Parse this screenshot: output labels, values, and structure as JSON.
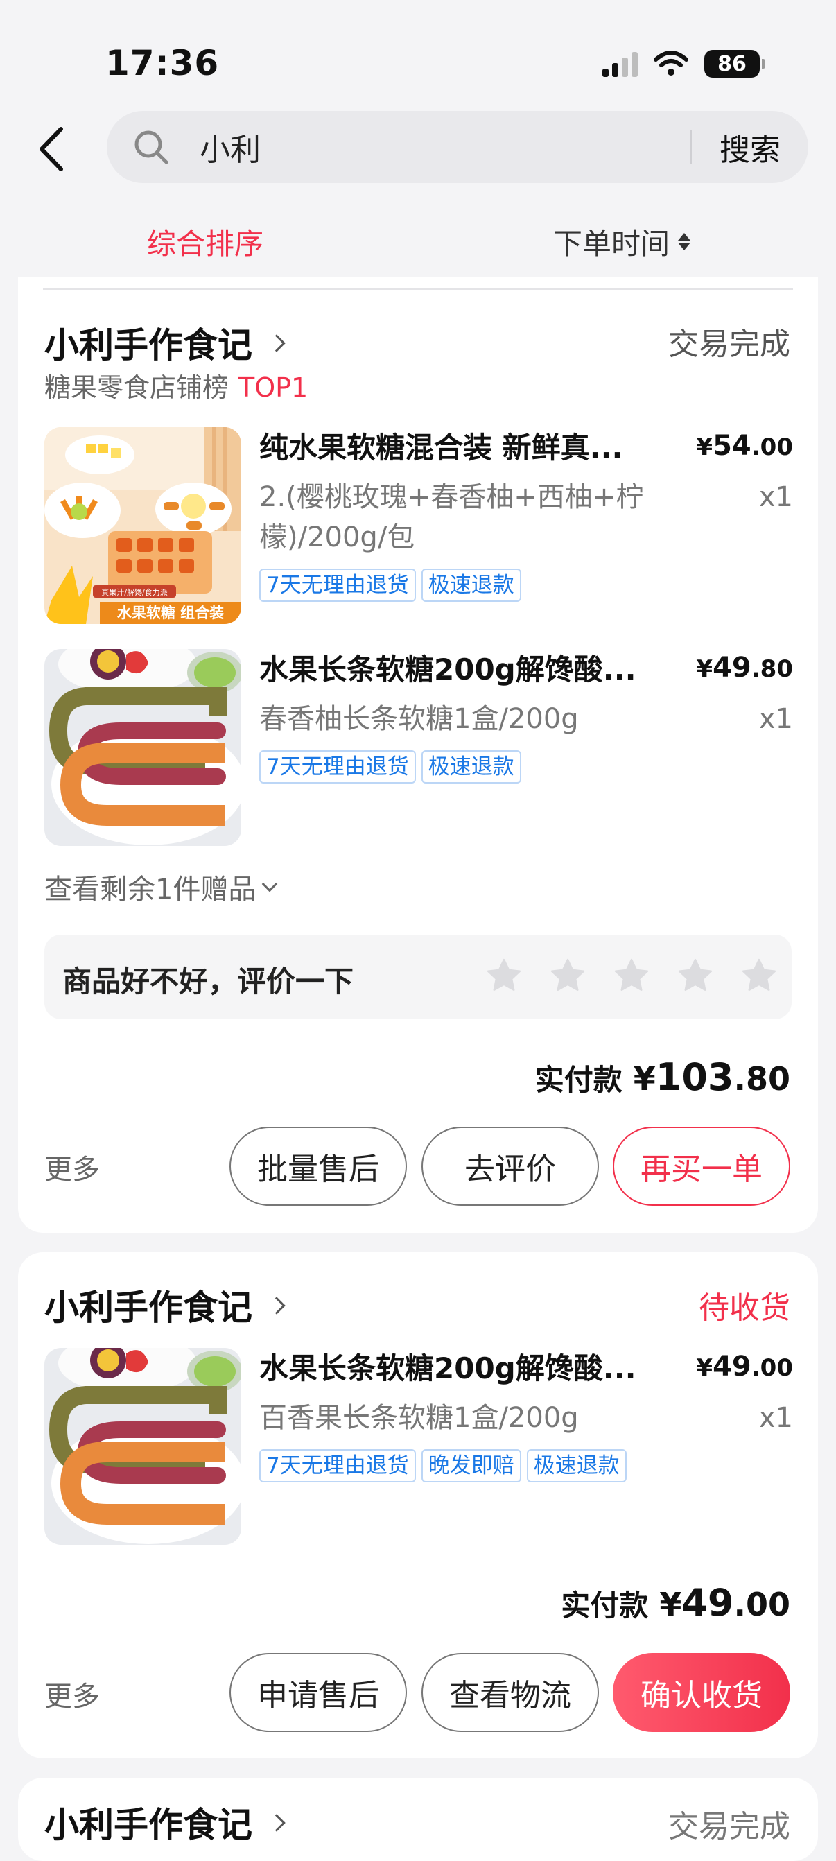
{
  "status_bar": {
    "time": "17:36",
    "battery": "86"
  },
  "search": {
    "query": "小利",
    "button": "搜索"
  },
  "sort": {
    "composite": "综合排序",
    "order_time": "下单时间"
  },
  "orders": [
    {
      "shop": "小利手作食记",
      "status": "交易完成",
      "rank_label": "糖果零食店铺榜",
      "rank_badge": "TOP1",
      "items": [
        {
          "title": "纯水果软糖混合装 新鲜真...",
          "price_currency": "¥",
          "price_int": "54",
          "price_dec": ".00",
          "spec": "2.(樱桃玫瑰+春香柚+西柚+柠檬)/200g/包",
          "qty": "x1",
          "thumb_caption": "水果软糖 组合装",
          "thumb_banner": "真果汁/解馋/食力派",
          "tags": [
            "7天无理由退货",
            "极速退款"
          ]
        },
        {
          "title": "水果长条软糖200g解馋酸...",
          "price_currency": "¥",
          "price_int": "49",
          "price_dec": ".80",
          "spec": "春香柚长条软糖1盒/200g",
          "qty": "x1",
          "tags": [
            "7天无理由退货",
            "极速退款"
          ]
        }
      ],
      "gift_text": "查看剩余1件赠品",
      "rate_prompt": "商品好不好，评价一下",
      "paid_label": "实付款",
      "paid_currency": "¥",
      "paid_int": "103",
      "paid_dec": ".80",
      "more": "更多",
      "buttons": [
        "批量售后",
        "去评价",
        "再买一单"
      ]
    },
    {
      "shop": "小利手作食记",
      "status": "待收货",
      "items": [
        {
          "title": "水果长条软糖200g解馋酸...",
          "price_currency": "¥",
          "price_int": "49",
          "price_dec": ".00",
          "spec": "百香果长条软糖1盒/200g",
          "qty": "x1",
          "tags": [
            "7天无理由退货",
            "晚发即赔",
            "极速退款"
          ]
        }
      ],
      "paid_label": "实付款",
      "paid_currency": "¥",
      "paid_int": "49",
      "paid_dec": ".00",
      "more": "更多",
      "buttons": [
        "申请售后",
        "查看物流",
        "确认收货"
      ]
    },
    {
      "shop": "小利手作食记",
      "status": "交易完成"
    }
  ],
  "colors": {
    "accent": "#f2304b",
    "tag_blue": "#1a78e6",
    "bg": "#f4f4f6"
  }
}
